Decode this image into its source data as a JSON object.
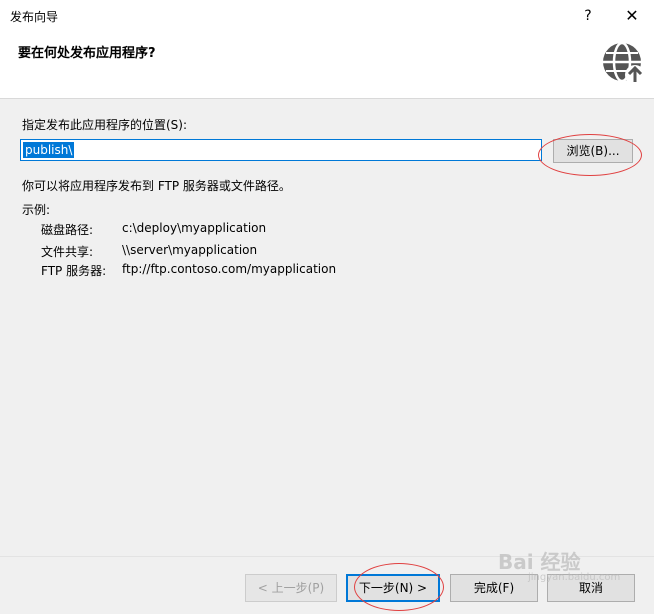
{
  "window": {
    "title": "发布向导",
    "help_label": "?",
    "close_label": "✕"
  },
  "header": {
    "heading": "要在何处发布应用程序?",
    "icon": "globe-publish-icon"
  },
  "location": {
    "label": "指定发布此应用程序的位置(S):",
    "value": "publish\\",
    "browse_label": "浏览(B)..."
  },
  "info_text": "你可以将应用程序发布到 FTP 服务器或文件路径。",
  "examples": {
    "heading": "示例:",
    "rows": [
      {
        "key": "磁盘路径:",
        "value": "c:\\deploy\\myapplication"
      },
      {
        "key": "文件共享:",
        "value": "\\\\server\\myapplication"
      },
      {
        "key": "FTP 服务器:",
        "value": "ftp://ftp.contoso.com/myapplication"
      }
    ]
  },
  "buttons": {
    "prev": "< 上一步(P)",
    "next": "下一步(N) >",
    "finish": "完成(F)",
    "cancel": "取消"
  },
  "watermark": {
    "text": "Bai 经验",
    "sub": "jingyan.baidu.com"
  },
  "colors": {
    "accent": "#0078d7",
    "annotation": "#e04040"
  }
}
